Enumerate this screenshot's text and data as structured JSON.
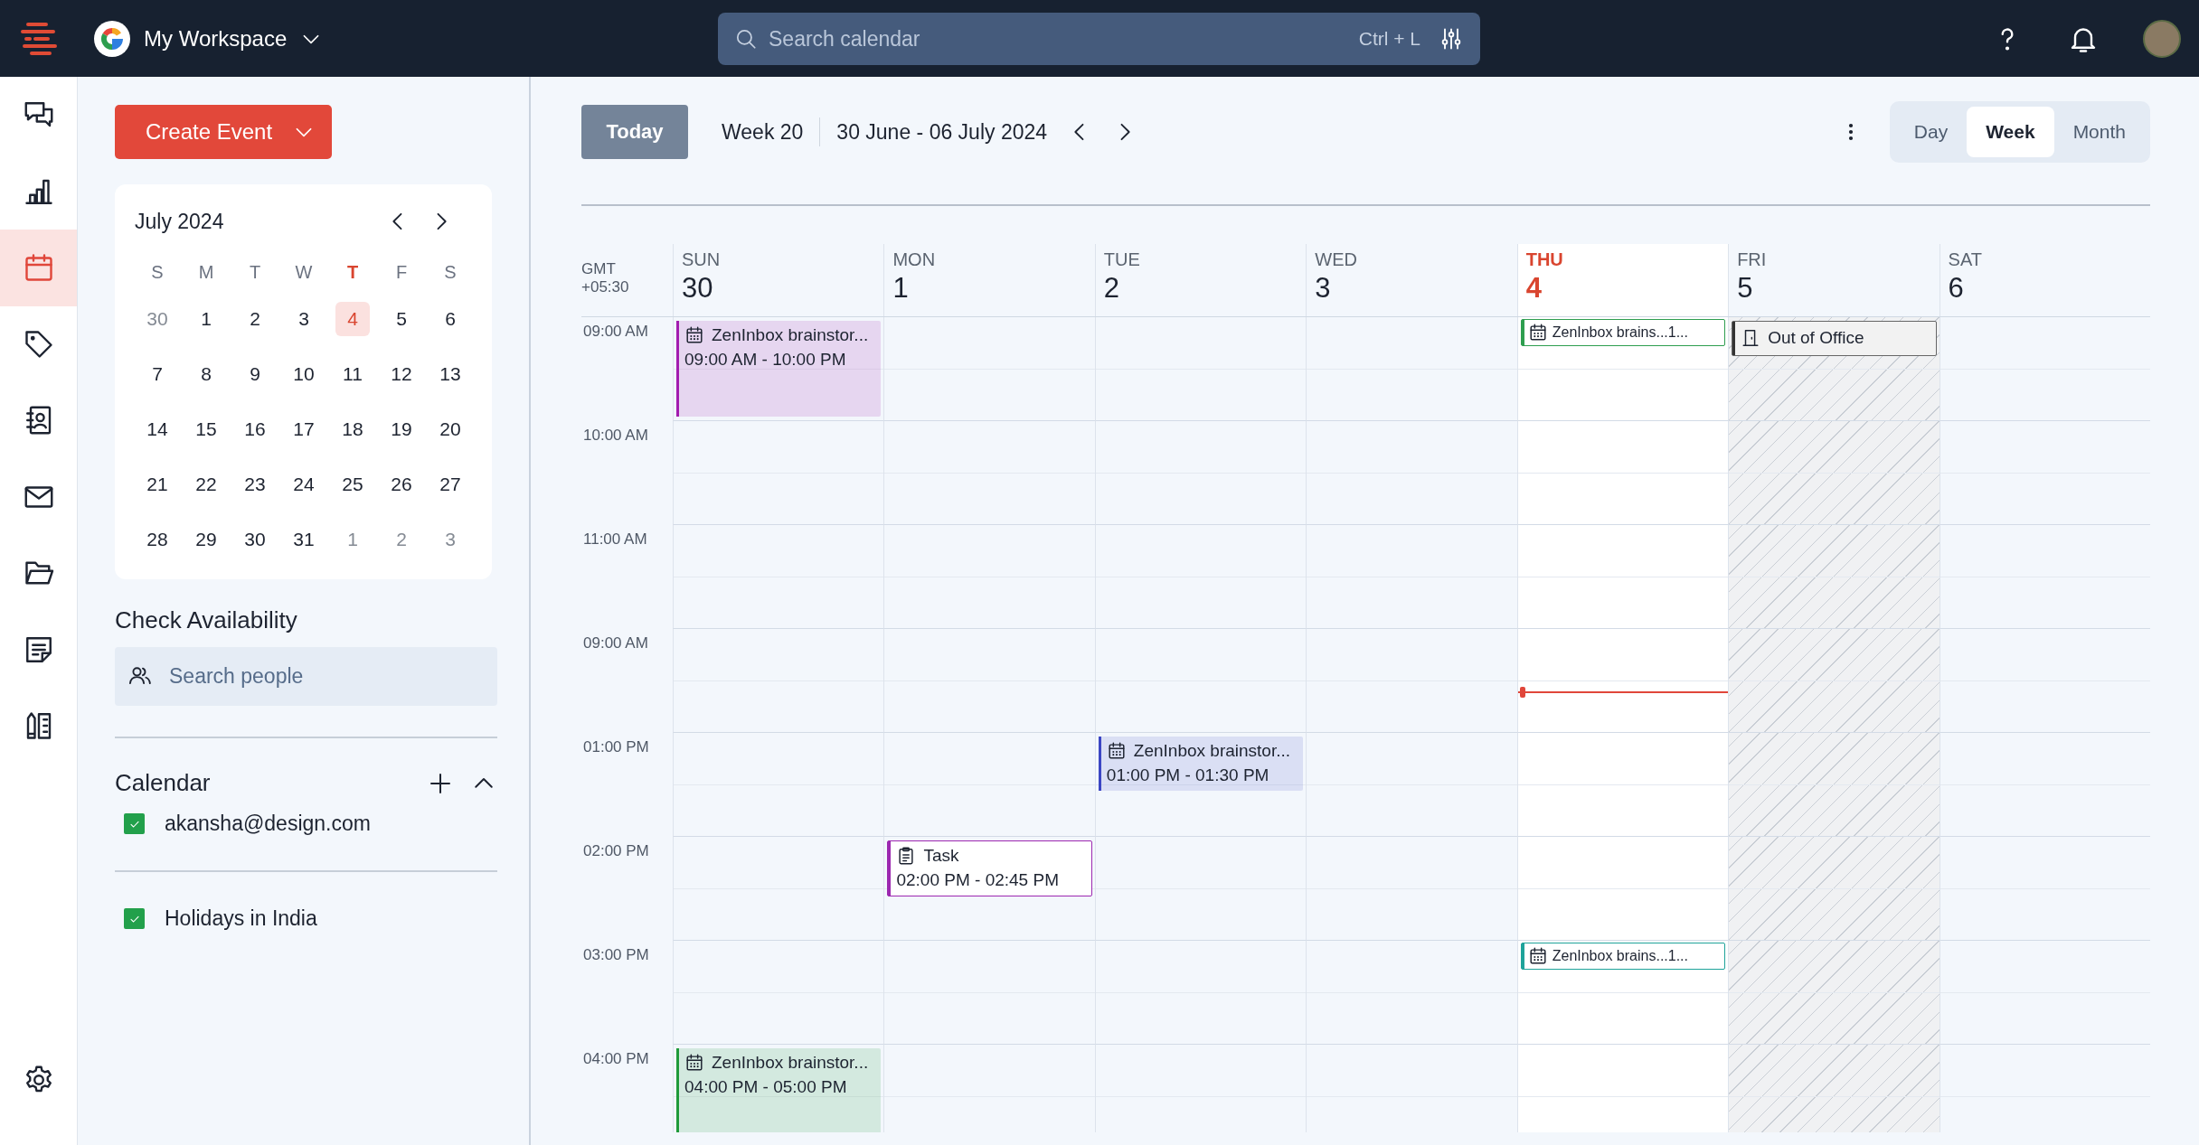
{
  "topbar": {
    "workspace": "My Workspace",
    "search": {
      "placeholder": "Search calendar",
      "shortcut": "Ctrl + L"
    }
  },
  "rail": {
    "items": [
      {
        "kind": "chat",
        "selected": false
      },
      {
        "kind": "chart",
        "selected": false
      },
      {
        "kind": "calendar",
        "selected": true
      },
      {
        "kind": "tag",
        "selected": false
      },
      {
        "kind": "contacts",
        "selected": false
      },
      {
        "kind": "mail",
        "selected": false
      },
      {
        "kind": "folder",
        "selected": false
      },
      {
        "kind": "notes",
        "selected": false
      },
      {
        "kind": "books",
        "selected": false
      }
    ]
  },
  "create_button": "Create Event",
  "mini_calendar": {
    "title": "July 2024",
    "weekdays": [
      {
        "label": "S",
        "today": false
      },
      {
        "label": "M",
        "today": false
      },
      {
        "label": "T",
        "today": false
      },
      {
        "label": "W",
        "today": false
      },
      {
        "label": "T",
        "today": true
      },
      {
        "label": "F",
        "today": false
      },
      {
        "label": "S",
        "today": false
      }
    ],
    "weeks": [
      [
        {
          "label": "30",
          "outside": true,
          "selected": false
        },
        {
          "label": "1",
          "outside": false,
          "selected": false
        },
        {
          "label": "2",
          "outside": false,
          "selected": false
        },
        {
          "label": "3",
          "outside": false,
          "selected": false
        },
        {
          "label": "4",
          "outside": false,
          "selected": true
        },
        {
          "label": "5",
          "outside": false,
          "selected": false
        },
        {
          "label": "6",
          "outside": false,
          "selected": false
        }
      ],
      [
        {
          "label": "7",
          "outside": false,
          "selected": false
        },
        {
          "label": "8",
          "outside": false,
          "selected": false
        },
        {
          "label": "9",
          "outside": false,
          "selected": false
        },
        {
          "label": "10",
          "outside": false,
          "selected": false
        },
        {
          "label": "11",
          "outside": false,
          "selected": false
        },
        {
          "label": "12",
          "outside": false,
          "selected": false
        },
        {
          "label": "13",
          "outside": false,
          "selected": false
        }
      ],
      [
        {
          "label": "14",
          "outside": false,
          "selected": false
        },
        {
          "label": "15",
          "outside": false,
          "selected": false
        },
        {
          "label": "16",
          "outside": false,
          "selected": false
        },
        {
          "label": "17",
          "outside": false,
          "selected": false
        },
        {
          "label": "18",
          "outside": false,
          "selected": false
        },
        {
          "label": "19",
          "outside": false,
          "selected": false
        },
        {
          "label": "20",
          "outside": false,
          "selected": false
        }
      ],
      [
        {
          "label": "21",
          "outside": false,
          "selected": false
        },
        {
          "label": "22",
          "outside": false,
          "selected": false
        },
        {
          "label": "23",
          "outside": false,
          "selected": false
        },
        {
          "label": "24",
          "outside": false,
          "selected": false
        },
        {
          "label": "25",
          "outside": false,
          "selected": false
        },
        {
          "label": "26",
          "outside": false,
          "selected": false
        },
        {
          "label": "27",
          "outside": false,
          "selected": false
        }
      ],
      [
        {
          "label": "28",
          "outside": false,
          "selected": false
        },
        {
          "label": "29",
          "outside": false,
          "selected": false
        },
        {
          "label": "30",
          "outside": false,
          "selected": false
        },
        {
          "label": "31",
          "outside": false,
          "selected": false
        },
        {
          "label": "1",
          "outside": true,
          "selected": false
        },
        {
          "label": "2",
          "outside": true,
          "selected": false
        },
        {
          "label": "3",
          "outside": true,
          "selected": false
        }
      ]
    ]
  },
  "availability": {
    "title": "Check Availability",
    "placeholder": "Search people"
  },
  "calendars": {
    "title": "Calendar",
    "items": [
      {
        "label": "akansha@design.com",
        "checked": true
      },
      {
        "label": "Holidays in India",
        "checked": true
      }
    ]
  },
  "toolbar": {
    "today": "Today",
    "week": "Week 20",
    "range": "30 June - 06 July 2024",
    "views": [
      {
        "label": "Day",
        "selected": false
      },
      {
        "label": "Week",
        "selected": true
      },
      {
        "label": "Month",
        "selected": false
      }
    ]
  },
  "timezone": {
    "name": "GMT",
    "offset": "+05:30"
  },
  "days": [
    {
      "name": "SUN",
      "date": "30",
      "today": false
    },
    {
      "name": "MON",
      "date": "1",
      "today": false
    },
    {
      "name": "TUE",
      "date": "2",
      "today": false
    },
    {
      "name": "WED",
      "date": "3",
      "today": false
    },
    {
      "name": "THU",
      "date": "4",
      "today": true
    },
    {
      "name": "FRI",
      "date": "5",
      "today": false
    },
    {
      "name": "SAT",
      "date": "6",
      "today": false
    }
  ],
  "time_rows": [
    {
      "label": "09:00 AM",
      "cells": [
        {
          "unavailable": false,
          "current_time": false,
          "events": [
            {
              "kind": "block",
              "title": "ZenInbox brainstor...",
              "time": "09:00 AM - 10:00 PM",
              "color": "#a21caf"
            }
          ]
        },
        {
          "unavailable": false,
          "current_time": false
        },
        {
          "unavailable": false,
          "current_time": false
        },
        {
          "unavailable": false,
          "current_time": false
        },
        {
          "unavailable": false,
          "current_time": false,
          "events": [
            {
              "kind": "chip",
              "title": "ZenInbox brains...1...",
              "color": "#2e9e4f"
            }
          ]
        },
        {
          "unavailable": true,
          "current_time": false,
          "events": [
            {
              "kind": "away",
              "title": "Out of Office",
              "color": "#333333"
            }
          ]
        },
        {
          "unavailable": false,
          "current_time": false
        }
      ]
    },
    {
      "label": "10:00 AM",
      "cells": [
        {
          "unavailable": false,
          "current_time": false
        },
        {
          "unavailable": false,
          "current_time": false
        },
        {
          "unavailable": false,
          "current_time": false
        },
        {
          "unavailable": false,
          "current_time": false
        },
        {
          "unavailable": false,
          "current_time": false
        },
        {
          "unavailable": true,
          "current_time": false
        },
        {
          "unavailable": false,
          "current_time": false
        }
      ]
    },
    {
      "label": "11:00 AM",
      "cells": [
        {
          "unavailable": false,
          "current_time": false
        },
        {
          "unavailable": false,
          "current_time": false
        },
        {
          "unavailable": false,
          "current_time": false
        },
        {
          "unavailable": false,
          "current_time": false
        },
        {
          "unavailable": false,
          "current_time": false
        },
        {
          "unavailable": true,
          "current_time": false
        },
        {
          "unavailable": false,
          "current_time": false
        }
      ]
    },
    {
      "label": "09:00 AM",
      "cells": [
        {
          "unavailable": false,
          "current_time": false
        },
        {
          "unavailable": false,
          "current_time": false
        },
        {
          "unavailable": false,
          "current_time": false
        },
        {
          "unavailable": false,
          "current_time": false
        },
        {
          "unavailable": false,
          "current_time": true
        },
        {
          "unavailable": true,
          "current_time": false
        },
        {
          "unavailable": false,
          "current_time": false
        }
      ]
    },
    {
      "label": "01:00 PM",
      "cells": [
        {
          "unavailable": false,
          "current_time": false
        },
        {
          "unavailable": false,
          "current_time": false
        },
        {
          "unavailable": false,
          "current_time": false,
          "events": [
            {
              "kind": "card",
              "title": "ZenInbox brainstor...",
              "time": "01:00 PM - 01:30 PM",
              "color": "#3b46c4"
            }
          ]
        },
        {
          "unavailable": false,
          "current_time": false
        },
        {
          "unavailable": false,
          "current_time": false
        },
        {
          "unavailable": true,
          "current_time": false
        },
        {
          "unavailable": false,
          "current_time": false
        }
      ]
    },
    {
      "label": "02:00 PM",
      "cells": [
        {
          "unavailable": false,
          "current_time": false
        },
        {
          "unavailable": false,
          "current_time": false,
          "events": [
            {
              "kind": "task",
              "title": "Task",
              "time": "02:00 PM - 02:45 PM",
              "color": "#9c27b0"
            }
          ]
        },
        {
          "unavailable": false,
          "current_time": false
        },
        {
          "unavailable": false,
          "current_time": false
        },
        {
          "unavailable": false,
          "current_time": false
        },
        {
          "unavailable": true,
          "current_time": false
        },
        {
          "unavailable": false,
          "current_time": false
        }
      ]
    },
    {
      "label": "03:00 PM",
      "cells": [
        {
          "unavailable": false,
          "current_time": false
        },
        {
          "unavailable": false,
          "current_time": false
        },
        {
          "unavailable": false,
          "current_time": false
        },
        {
          "unavailable": false,
          "current_time": false
        },
        {
          "unavailable": false,
          "current_time": false,
          "events": [
            {
              "kind": "chip",
              "title": "ZenInbox brains...1...",
              "color": "#1ea39a"
            }
          ]
        },
        {
          "unavailable": true,
          "current_time": false
        },
        {
          "unavailable": false,
          "current_time": false
        }
      ]
    },
    {
      "label": "04:00 PM",
      "cells": [
        {
          "unavailable": false,
          "current_time": false,
          "events": [
            {
              "kind": "block",
              "title": "ZenInbox brainstor...",
              "time": "04:00 PM - 05:00 PM",
              "color": "#1f9a3a"
            }
          ]
        },
        {
          "unavailable": false,
          "current_time": false
        },
        {
          "unavailable": false,
          "current_time": false
        },
        {
          "unavailable": false,
          "current_time": false
        },
        {
          "unavailable": false,
          "current_time": false
        },
        {
          "unavailable": true,
          "current_time": false
        },
        {
          "unavailable": false,
          "current_time": false
        }
      ]
    }
  ]
}
